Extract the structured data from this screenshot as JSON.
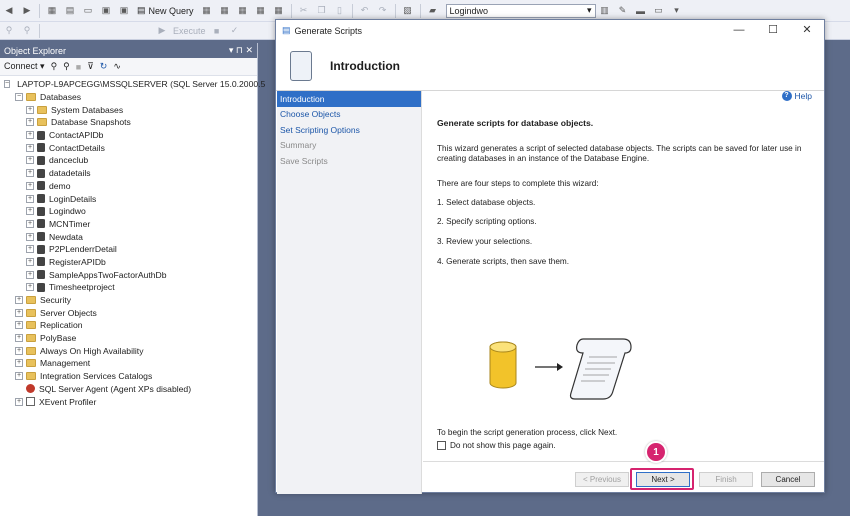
{
  "toolbar": {
    "new_query_label": "New Query",
    "execute_label": "Execute",
    "database_dropdown_value": "Logindwo"
  },
  "object_explorer": {
    "title": "Object Explorer",
    "pin_glyphs": "▾ ⊓ ✕",
    "connect_label": "Connect",
    "server_node": "LAPTOP-L9APCEGG\\MSSQLSERVER (SQL Server 15.0.2000.5",
    "databases_label": "Databases",
    "databases": [
      "System Databases",
      "Database Snapshots",
      "ContactAPIDb",
      "ContactDetails",
      "danceclub",
      "datadetails",
      "demo",
      "LoginDetails",
      "Logindwo",
      "MCNTimer",
      "Newdata",
      "P2PLenderrDetail",
      "RegisterAPIDb",
      "SampleAppsTwoFactorAuthDb",
      "Timesheetproject"
    ],
    "top_folders": [
      "Security",
      "Server Objects",
      "Replication",
      "PolyBase",
      "Always On High Availability",
      "Management",
      "Integration Services Catalogs"
    ],
    "agent_label": "SQL Server Agent (Agent XPs disabled)",
    "xevent_label": "XEvent Profiler"
  },
  "dialog": {
    "title": "Generate Scripts",
    "heading": "Introduction",
    "help_label": "Help",
    "nav": [
      {
        "label": "Introduction",
        "state": "active"
      },
      {
        "label": "Choose Objects",
        "state": "link"
      },
      {
        "label": "Set Scripting Options",
        "state": "link"
      },
      {
        "label": "Summary",
        "state": "dim"
      },
      {
        "label": "Save Scripts",
        "state": "dim"
      }
    ],
    "content": {
      "headline": "Generate scripts for database objects.",
      "para1_line1": "This wizard generates a script of selected database objects. The scripts can be saved for later use in",
      "para1_line2": "creating databases in an instance of the Database Engine.",
      "steps_intro": "There are four steps to complete this wizard:",
      "step1": "1. Select database objects.",
      "step2": "2. Specify scripting options.",
      "step3": "3. Review your selections.",
      "step4": "4. Generate scripts, then save them.",
      "begin_text": "To begin the script generation process, click Next.",
      "checkbox_label": "Do not show this page again."
    },
    "buttons": {
      "previous": "< Previous",
      "next": "Next >",
      "finish": "Finish",
      "cancel": "Cancel"
    }
  },
  "annotation": {
    "badge": "1"
  },
  "colors": {
    "accent": "#2f6fc7",
    "highlight": "#d6246f",
    "titlebar": "#5d6b89"
  }
}
